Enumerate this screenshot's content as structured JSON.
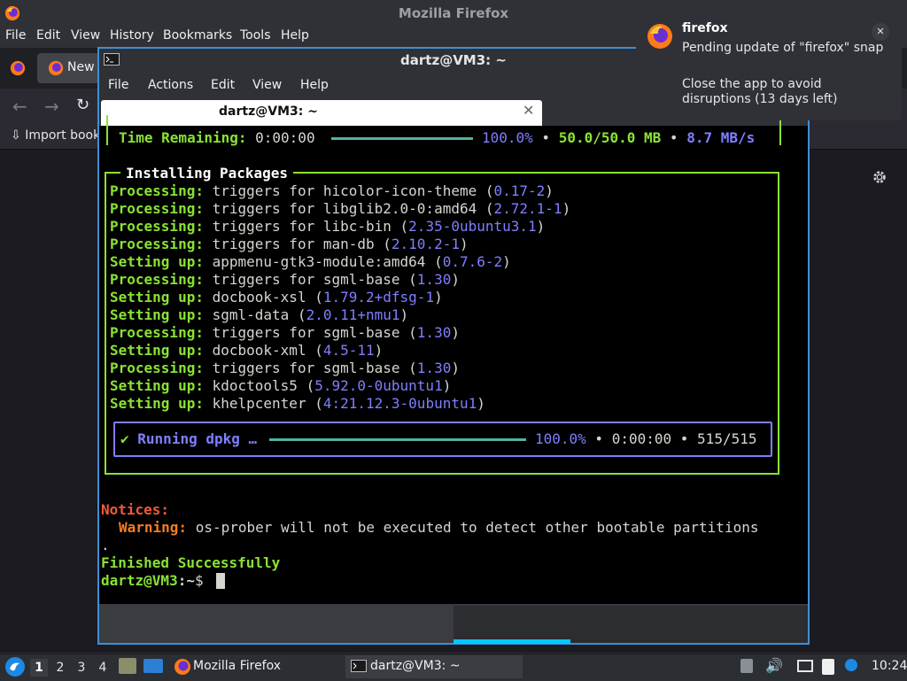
{
  "firefox": {
    "window_title": "Mozilla Firefox",
    "menu": [
      "File",
      "Edit",
      "View",
      "History",
      "Bookmarks",
      "Tools",
      "Help"
    ],
    "tab_label": "New",
    "bookmark_label": "Import book"
  },
  "terminal": {
    "window_title": "dartz@VM3: ~",
    "menu": [
      "File",
      "Actions",
      "Edit",
      "View",
      "Help"
    ],
    "tab_label": "dartz@VM3: ~",
    "download": {
      "label": "Time Remaining:",
      "time": "0:00:00",
      "percent": "100.0%",
      "size": "50.0/50.0 MB",
      "speed": "8.7 MB/s"
    },
    "install_header": "Installing Packages",
    "lines": [
      {
        "action": "Processing:",
        "text": "triggers for hicolor-icon-theme (",
        "ver": "0.17-2",
        "end": ")"
      },
      {
        "action": "Processing:",
        "text": "triggers for libglib2.0-0:amd64 (",
        "ver": "2.72.1-1",
        "end": ")"
      },
      {
        "action": "Processing:",
        "text": "triggers for libc-bin (",
        "ver": "2.35-0ubuntu3.1",
        "end": ")"
      },
      {
        "action": "Processing:",
        "text": "triggers for man-db (",
        "ver": "2.10.2-1",
        "end": ")"
      },
      {
        "action": "Setting up:",
        "text": "appmenu-gtk3-module:amd64 (",
        "ver": "0.7.6-2",
        "end": ")"
      },
      {
        "action": "Processing:",
        "text": "triggers for sgml-base (",
        "ver": "1.30",
        "end": ")"
      },
      {
        "action": "Setting up:",
        "text": "docbook-xsl (",
        "ver": "1.79.2+dfsg-1",
        "end": ")"
      },
      {
        "action": "Setting up:",
        "text": "sgml-data (",
        "ver": "2.0.11+nmu1",
        "end": ")"
      },
      {
        "action": "Processing:",
        "text": "triggers for sgml-base (",
        "ver": "1.30",
        "end": ")"
      },
      {
        "action": "Setting up:",
        "text": "docbook-xml (",
        "ver": "4.5-11",
        "end": ")"
      },
      {
        "action": "Processing:",
        "text": "triggers for sgml-base (",
        "ver": "1.30",
        "end": ")"
      },
      {
        "action": "Setting up:",
        "text": "kdoctools5 (",
        "ver": "5.92.0-0ubuntu1",
        "end": ")"
      },
      {
        "action": "Setting up:",
        "text": "khelpcenter (",
        "ver": "4:21.12.3-0ubuntu1",
        "end": ")"
      }
    ],
    "dpkg": {
      "check": "✔",
      "label": "Running dpkg …",
      "percent": "100.0%",
      "time": "0:00:00",
      "count": "515/515"
    },
    "notices_label": "Notices:",
    "warning_label": "Warning:",
    "warning_text": "os-prober will not be executed to detect other bootable partitions",
    "warning_wrap": ".",
    "finished": "Finished Successfully",
    "prompt_user": "dartz@VM3",
    "prompt_path": ":~",
    "prompt_sym": "$"
  },
  "notification": {
    "title": "firefox",
    "line1": "Pending update of \"firefox\" snap",
    "line2": "Close the app to avoid disruptions (13 days left)"
  },
  "taskbar": {
    "workspaces": [
      "1",
      "2",
      "3",
      "4"
    ],
    "firefox_task": "Mozilla Firefox",
    "terminal_task": "dartz@VM3: ~",
    "clock": "10:24"
  }
}
